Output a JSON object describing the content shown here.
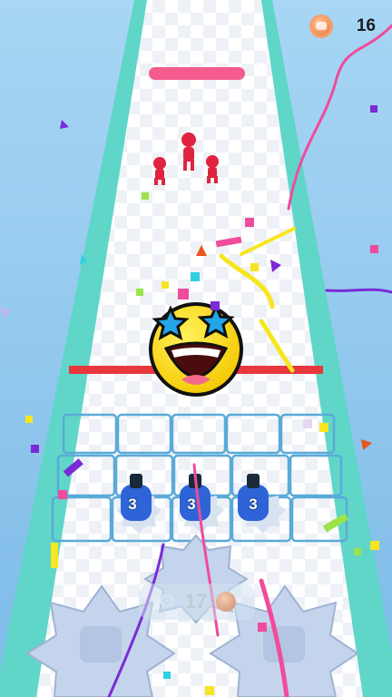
{
  "hud": {
    "coin_icon": "coin-icon",
    "coin_count": "16"
  },
  "enemy_health": {
    "fill": 1.0,
    "color": "#f55b8c"
  },
  "enemies": [
    {
      "kind": "red-runner"
    },
    {
      "kind": "red-runner"
    },
    {
      "kind": "red-runner"
    }
  ],
  "ball": {
    "face": "star-eyed-laughing-emoji"
  },
  "towers": [
    {
      "level": "3"
    },
    {
      "level": "3"
    },
    {
      "level": "3"
    }
  ],
  "spawn_cost": {
    "icon": "gear-icon",
    "value": "17",
    "currency_icon": "coin-icon"
  },
  "colors": {
    "track": "#ffffff",
    "track_edge": "#5fd6c8",
    "sky": "#8fc8f0",
    "tower": "#2f64d8",
    "saw": "#c4d4ec",
    "deadline": "#e8373d"
  }
}
